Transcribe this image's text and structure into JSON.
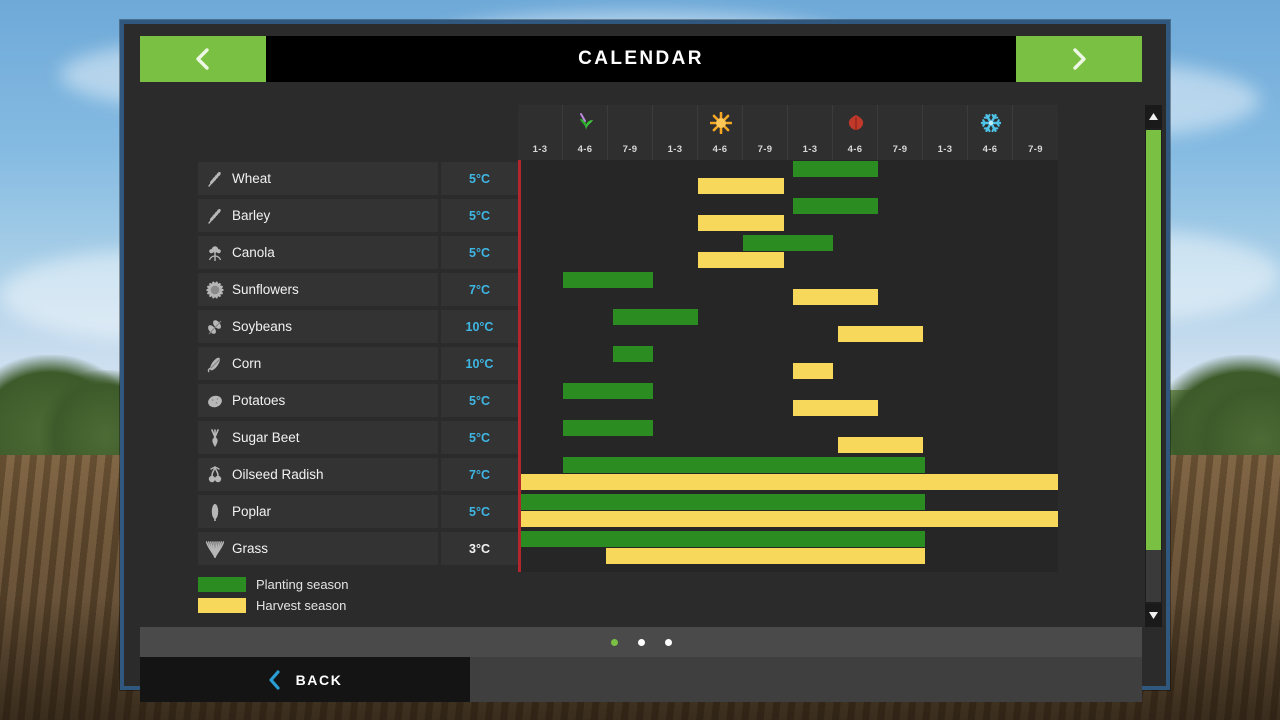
{
  "window": {
    "title": "CALENDAR",
    "prev_icon": "chevron-left-icon",
    "next_icon": "chevron-right-icon"
  },
  "seasons": [
    {
      "name": "Spring",
      "icon": "sprout-icon",
      "color": "#2fab2f",
      "periods": [
        "1-3",
        "4-6",
        "7-9"
      ]
    },
    {
      "name": "Summer",
      "icon": "sun-icon",
      "color": "#f5a623",
      "periods": [
        "1-3",
        "4-6",
        "7-9"
      ]
    },
    {
      "name": "Autumn",
      "icon": "leaf-icon",
      "color": "#c0392b",
      "periods": [
        "1-3",
        "4-6",
        "7-9"
      ]
    },
    {
      "name": "Winter",
      "icon": "snowflake-icon",
      "color": "#4fc3e8",
      "periods": [
        "1-3",
        "4-6",
        "7-9"
      ]
    }
  ],
  "legend": {
    "planting_label": "Planting season",
    "harvest_label": "Harvest season",
    "planting_color": "#2a8c21",
    "harvest_color": "#f7d85b"
  },
  "chart_data": {
    "type": "bar",
    "title": "CALENDAR",
    "xlabel": "",
    "ylabel": "",
    "grid": true,
    "legend_position": "bottom-left",
    "columns": [
      "Spring 1-3",
      "Spring 4-6",
      "Spring 7-9",
      "Summer 1-3",
      "Summer 4-6",
      "Summer 7-9",
      "Autumn 1-3",
      "Autumn 4-6",
      "Autumn 7-9",
      "Winter 1-3",
      "Winter 4-6",
      "Winter 7-9"
    ],
    "column_count": 12,
    "today_marker_column": 0,
    "series": [
      {
        "name": "Planting season",
        "color": "#2a8c21"
      },
      {
        "name": "Harvest season",
        "color": "#f7d85b"
      }
    ],
    "rows": [
      {
        "crop": "Wheat",
        "icon": "wheat-icon",
        "temp": "5°C",
        "planting": {
          "start": 6.1,
          "end": 8.0
        },
        "harvest": {
          "start": 4.0,
          "end": 5.9
        }
      },
      {
        "crop": "Barley",
        "icon": "barley-icon",
        "temp": "5°C",
        "planting": {
          "start": 6.1,
          "end": 8.0
        },
        "harvest": {
          "start": 4.0,
          "end": 5.9
        }
      },
      {
        "crop": "Canola",
        "icon": "canola-icon",
        "temp": "5°C",
        "planting": {
          "start": 5.0,
          "end": 7.0
        },
        "harvest": {
          "start": 4.0,
          "end": 5.9
        }
      },
      {
        "crop": "Sunflowers",
        "icon": "sunflower-icon",
        "temp": "7°C",
        "planting": {
          "start": 1.0,
          "end": 3.0
        },
        "harvest": {
          "start": 6.1,
          "end": 8.0
        }
      },
      {
        "crop": "Soybeans",
        "icon": "soybean-icon",
        "temp": "10°C",
        "planting": {
          "start": 2.1,
          "end": 4.0
        },
        "harvest": {
          "start": 7.1,
          "end": 9.0
        }
      },
      {
        "crop": "Corn",
        "icon": "corn-icon",
        "temp": "10°C",
        "planting": {
          "start": 2.1,
          "end": 3.0
        },
        "harvest": {
          "start": 6.1,
          "end": 7.0
        }
      },
      {
        "crop": "Potatoes",
        "icon": "potato-icon",
        "temp": "5°C",
        "planting": {
          "start": 1.0,
          "end": 3.0
        },
        "harvest": {
          "start": 6.1,
          "end": 8.0
        }
      },
      {
        "crop": "Sugar Beet",
        "icon": "sugar-beet-icon",
        "temp": "5°C",
        "planting": {
          "start": 1.0,
          "end": 3.0
        },
        "harvest": {
          "start": 7.1,
          "end": 9.0
        }
      },
      {
        "crop": "Oilseed Radish",
        "icon": "oilseed-radish-icon",
        "temp": "7°C",
        "planting": {
          "start": 1.0,
          "end": 9.05
        },
        "harvest": {
          "start": 0.0,
          "end": 12.0
        }
      },
      {
        "crop": "Poplar",
        "icon": "poplar-icon",
        "temp": "5°C",
        "planting": {
          "start": 0.0,
          "end": 9.05
        },
        "harvest": {
          "start": 0.0,
          "end": 12.0
        }
      },
      {
        "crop": "Grass",
        "icon": "grass-icon",
        "temp": "3°C",
        "temp_neutral": true,
        "planting": {
          "start": 0.0,
          "end": 9.05
        },
        "harvest": {
          "start": 1.95,
          "end": 9.05
        }
      }
    ]
  },
  "scrollbar": {
    "up_icon": "triangle-up-icon",
    "down_icon": "triangle-down-icon",
    "thumb_color": "#7ac143"
  },
  "pager": {
    "total": 3,
    "active": 1
  },
  "footer": {
    "back_label": "BACK",
    "back_icon": "chevron-left-icon"
  }
}
